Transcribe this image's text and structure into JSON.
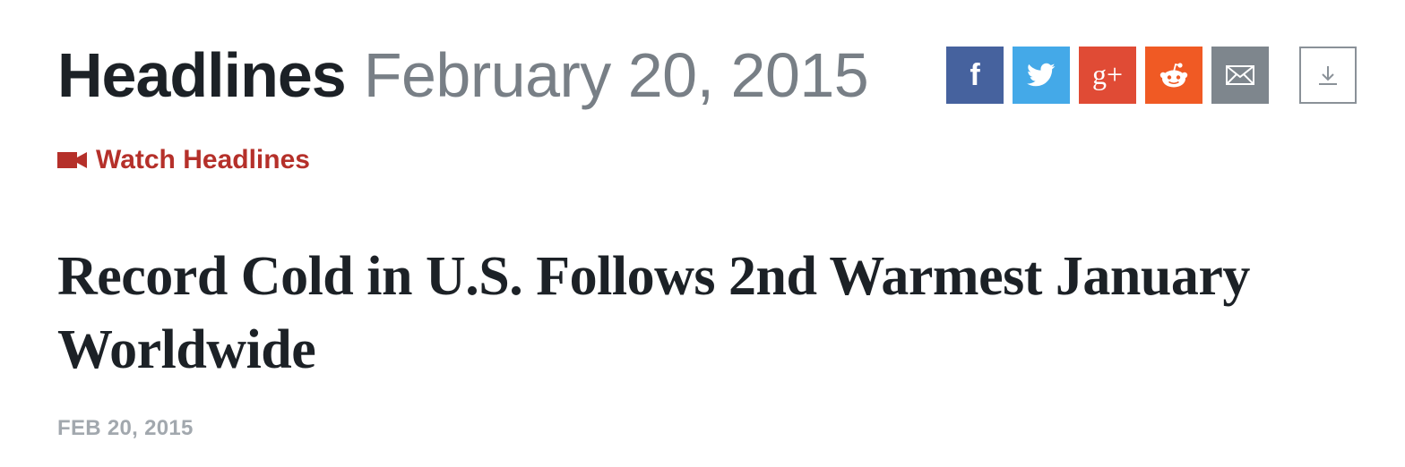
{
  "header": {
    "title": "Headlines",
    "date": "February 20, 2015"
  },
  "share": {
    "buttons": [
      {
        "name": "facebook",
        "icon": "facebook-icon",
        "glyph": "f",
        "color": "#46629e"
      },
      {
        "name": "twitter",
        "icon": "twitter-icon",
        "color": "#44a9e8"
      },
      {
        "name": "google-plus",
        "icon": "google-plus-icon",
        "glyph": "g+",
        "color": "#e04b35"
      },
      {
        "name": "reddit",
        "icon": "reddit-icon",
        "color": "#f05a24"
      },
      {
        "name": "email",
        "icon": "mail-icon",
        "color": "#7e868d"
      }
    ],
    "download": {
      "icon": "download-icon",
      "color": "#8a9198"
    }
  },
  "watch": {
    "label": "Watch Headlines",
    "icon": "video-camera-icon",
    "color": "#b5302a"
  },
  "story": {
    "title": "Record Cold in U.S. Follows 2nd Warmest January Worldwide",
    "date": "FEB 20, 2015"
  }
}
